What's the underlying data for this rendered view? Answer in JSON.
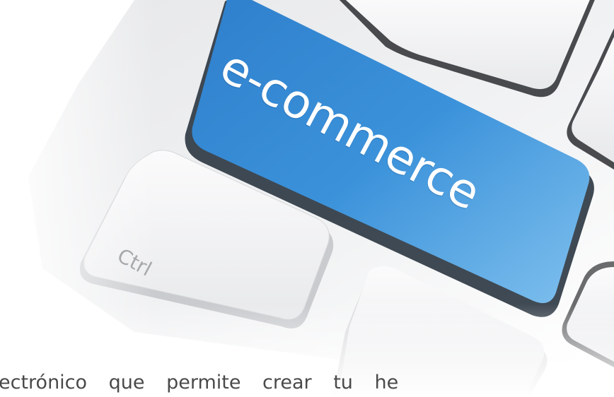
{
  "keyboard": {
    "ecommerce_key_label": "e-commerce",
    "ctrl_key_label": "Ctrl"
  },
  "caption": {
    "text": "ectrónico que permite crear tu he"
  },
  "colors": {
    "ecommerce_key": "#3a8fd6",
    "keyboard_body": "#f0f1f2",
    "caption_text": "#4a4a4a"
  }
}
